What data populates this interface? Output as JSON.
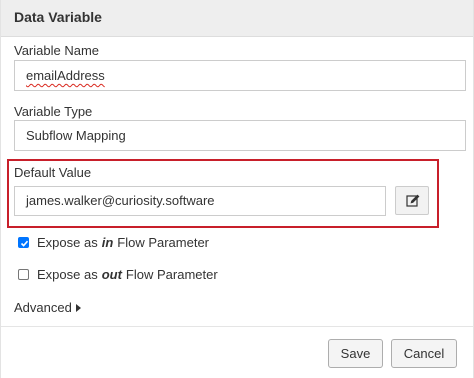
{
  "dialog": {
    "title": "Data Variable"
  },
  "variable_name": {
    "label": "Variable Name",
    "value": "emailAddress"
  },
  "variable_type": {
    "label": "Variable Type",
    "value": "Subflow Mapping"
  },
  "default_value": {
    "label": "Default Value",
    "value": "james.walker@curiosity.software",
    "edit_icon": "pencil-edit-icon",
    "highlight_color": "#c81f2a"
  },
  "expose_in": {
    "checked": true,
    "prefix": "Expose as",
    "keyword": "in",
    "suffix": "Flow Parameter"
  },
  "expose_out": {
    "checked": false,
    "prefix": "Expose as",
    "keyword": "out",
    "suffix": "Flow Parameter"
  },
  "advanced": {
    "label": "Advanced"
  },
  "footer": {
    "save_label": "Save",
    "cancel_label": "Cancel"
  }
}
